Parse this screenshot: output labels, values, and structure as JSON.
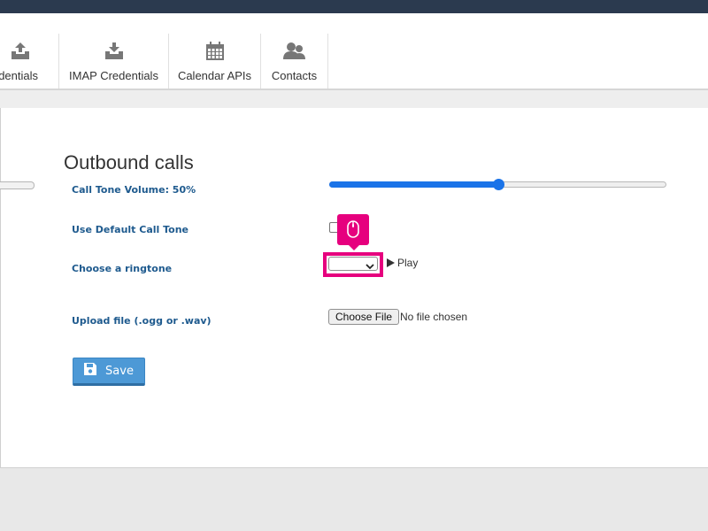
{
  "tabs": [
    {
      "label": "edentials",
      "icon": "upload-tray-icon"
    },
    {
      "label": "IMAP Credentials",
      "icon": "download-tray-icon"
    },
    {
      "label": "Calendar APIs",
      "icon": "calendar-icon"
    },
    {
      "label": "Contacts",
      "icon": "contacts-icon"
    }
  ],
  "section": {
    "title": "Outbound calls"
  },
  "fields": {
    "volume_label": "Call Tone Volume: 50%",
    "volume_value": 50,
    "default_tone_label": "Use Default Call Tone",
    "default_tone_checked": false,
    "ringtone_label": "Choose a ringtone",
    "ringtone_selected": "",
    "play_label": "Play",
    "upload_label": "Upload file (.ogg or .wav)",
    "choose_file_label": "Choose File",
    "no_file_text": "No file chosen"
  },
  "save_label": "Save",
  "colors": {
    "topbar": "#2b3a4f",
    "accent": "#1a73e8",
    "label_blue": "#1e5a8e",
    "highlight": "#e6007e",
    "save_button": "#4d99d6"
  }
}
